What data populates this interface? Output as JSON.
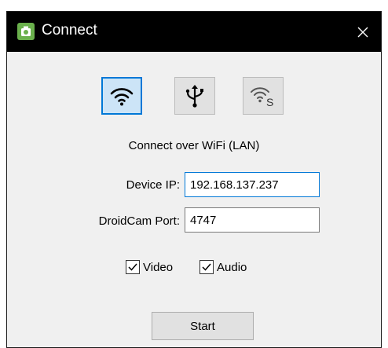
{
  "window": {
    "title": "Connect",
    "app_icon": "droidcam-camera-icon",
    "close_icon": "close-icon"
  },
  "modes": [
    {
      "icon": "wifi-icon",
      "selected": true
    },
    {
      "icon": "usb-icon",
      "selected": false
    },
    {
      "icon": "wifi-server-icon",
      "selected": false,
      "glyph": "S"
    }
  ],
  "subtitle": "Connect over WiFi (LAN)",
  "device_ip": {
    "label": "Device IP:",
    "value": "192.168.137.237"
  },
  "port": {
    "label": "DroidCam Port:",
    "value": "4747"
  },
  "options": {
    "video": {
      "label": "Video",
      "checked": true
    },
    "audio": {
      "label": "Audio",
      "checked": true
    }
  },
  "start_label": "Start",
  "colors": {
    "accent": "#0078d7",
    "titlebar": "#000000",
    "body": "#f0f0f0"
  }
}
